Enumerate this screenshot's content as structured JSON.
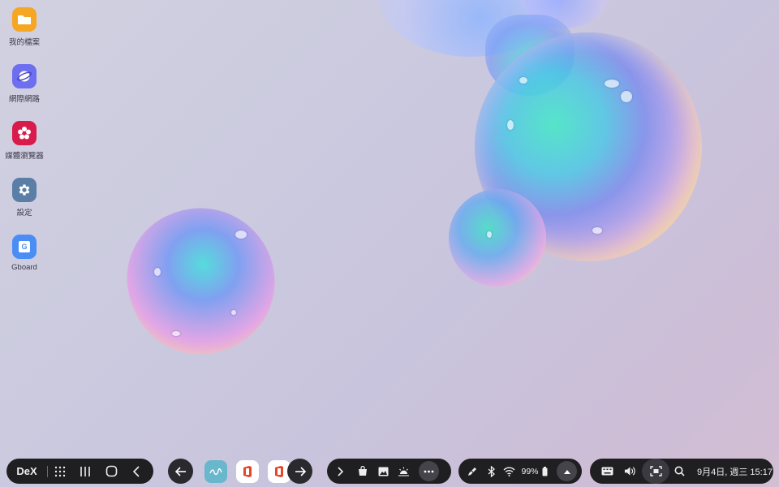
{
  "desktop": {
    "icons": [
      {
        "label": "我的檔案",
        "icon": "folder-icon",
        "color": "#f5a623"
      },
      {
        "label": "網際網路",
        "icon": "internet-icon",
        "color": "#6e6ef0"
      },
      {
        "label": "媒體瀏覽器",
        "icon": "flower-icon",
        "color": "#d81b4a"
      },
      {
        "label": "設定",
        "icon": "gear-icon",
        "color": "#5a7ea6"
      },
      {
        "label": "Gboard",
        "icon": "gboard-icon",
        "color": "#4a8ef5"
      }
    ]
  },
  "taskbar": {
    "dex_label": "DeX",
    "nav": [
      "apps-grid-icon",
      "recents-icon",
      "home-icon",
      "back-icon"
    ],
    "apps": [
      "scroll-left-icon",
      "notes-app-icon",
      "office-app-icon",
      "office-app-icon",
      "scroll-right-icon"
    ],
    "tray": [
      "expand-icon",
      "store-icon",
      "gallery-icon",
      "weather-icon",
      "more-icon"
    ],
    "status": {
      "battery": "99%",
      "icons": [
        "pen-icon",
        "bluetooth-icon",
        "wifi-icon",
        "battery-icon",
        "up-arrow-icon"
      ]
    },
    "system": {
      "datetime": "9月4日, 週三 15:17",
      "icons": [
        "keyboard-icon",
        "volume-icon",
        "screenshot-icon",
        "search-icon"
      ]
    }
  },
  "colors": {
    "taskbar_bg": "#1f1f22",
    "accent": "#4a8ef5"
  }
}
